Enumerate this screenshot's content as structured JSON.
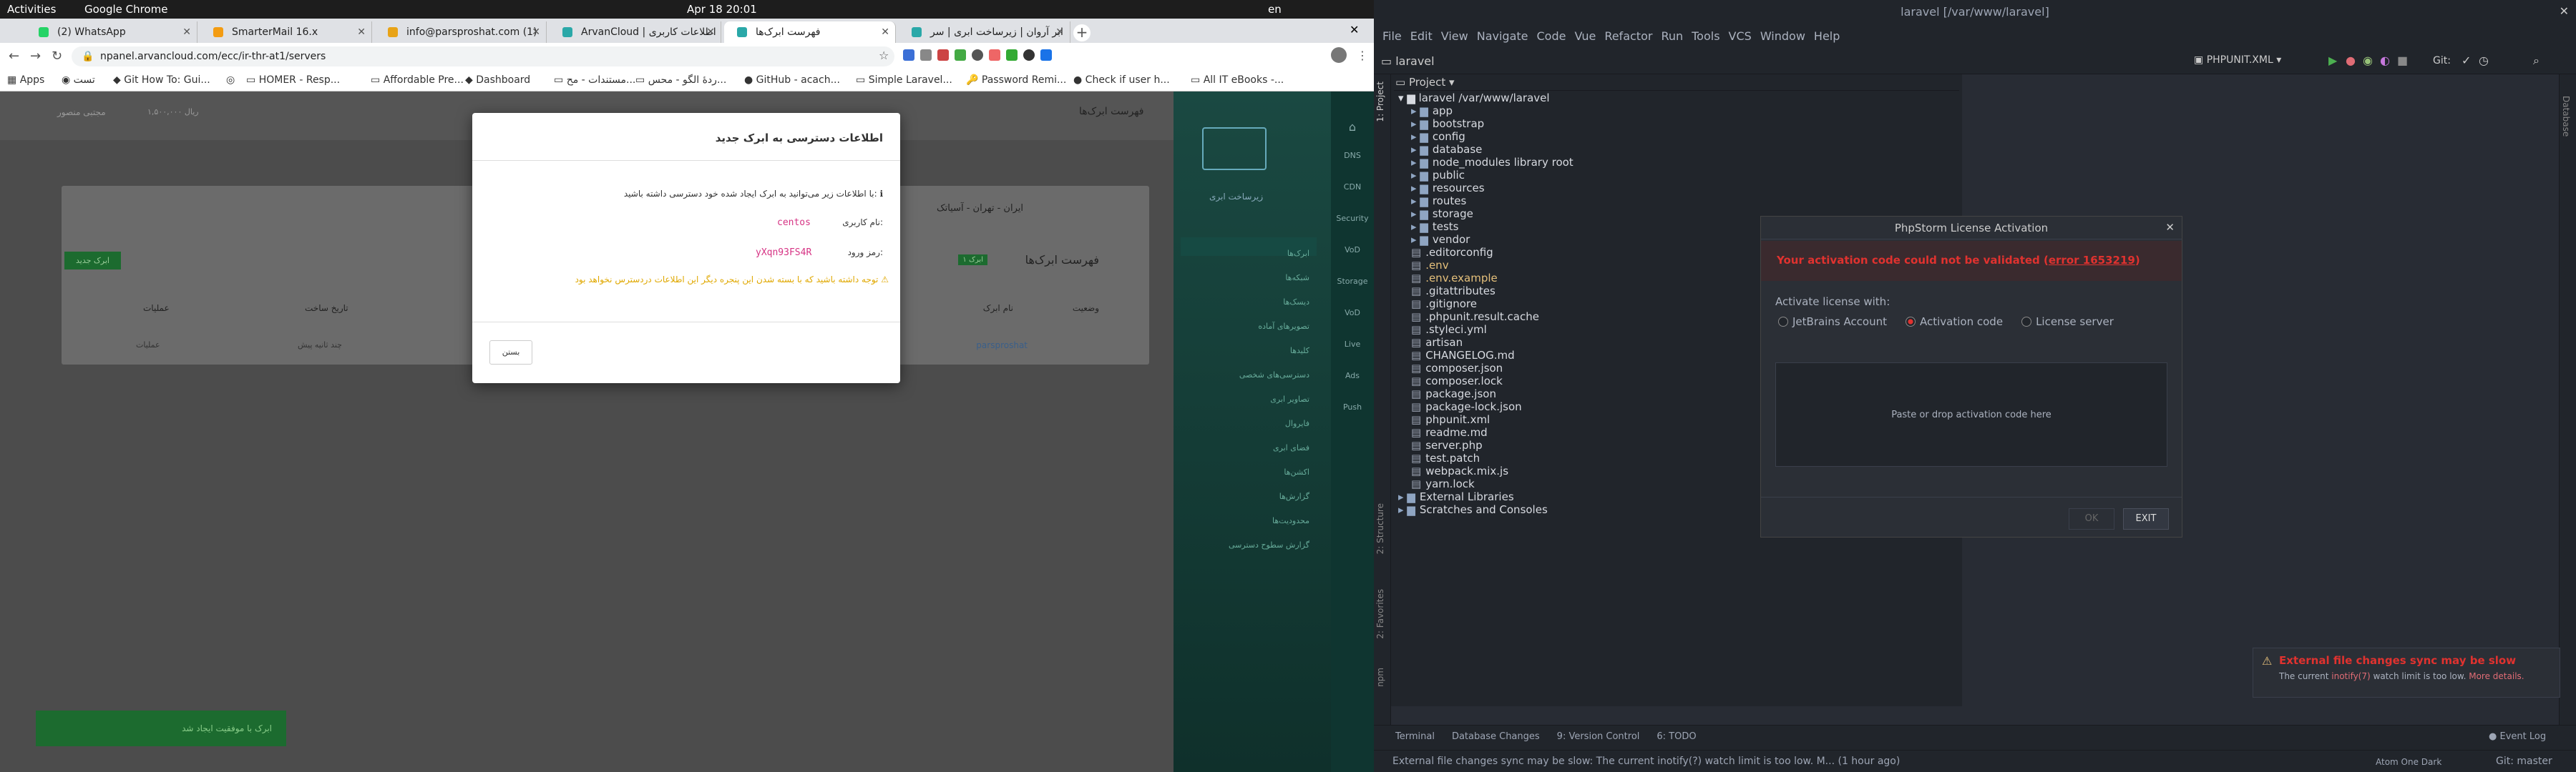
{
  "topbar": {
    "activities": "Activities",
    "app": "Google Chrome",
    "clock": "Apr 18  20:01",
    "lang": "en"
  },
  "chrome": {
    "tabs": [
      "(2) WhatsApp",
      "SmarterMail 16.x",
      "info@parsproshat.com (1)",
      "ArvanCloud | اطلاعات کاربری",
      "فهرست ابرک‌ها",
      "ابر آروان | زیرساخت ابری | سر"
    ],
    "active_tab": 4,
    "url": "npanel.arvancloud.com/ecc/ir-thr-at1/servers",
    "bookmarks": [
      "Apps",
      "تست",
      "Git How To: Gui...",
      "",
      "HOMER - Resp...",
      "Affordable Pre...",
      "Dashboard",
      "مستندات - مح...",
      "ردهٔ الگو - محس...",
      "GitHub - acach...",
      "Simple Laravel...",
      "Password Remi...",
      "Check if user h...",
      "All IT eBooks -..."
    ]
  },
  "panel": {
    "page_heading": "فهرست ابرک‌ها",
    "user_name": "مجتبی منصور",
    "balance": "۱,۵۰۰,۰۰۰ ریال",
    "region": "ایران - تهران - آسیاتک",
    "list_title": "فهرست ابرک‌ها",
    "list_badge": "۱ ابرک",
    "create_button": "ابرک جدید",
    "columns": [
      "وضعیت",
      "نام ابرک",
      "",
      "تاریخ ساخت",
      "عملیات"
    ],
    "row": {
      "name": "parsproshat",
      "created": "چند ثانیه پیش",
      "actions": "عملیات"
    },
    "toast": "ابرک با موفقیت ایجاد شد",
    "sidebar_brand": "زیرساخت ابری",
    "sidebar_items": [
      "ابرک‌ها",
      "شبکه‌ها",
      "دیسک‌ها",
      "تصویرهای آماده",
      "کلیدها",
      "دسترسی‌های شخصی",
      "تصاویر ابری",
      "فایروال",
      "فضای ابری",
      "اکشن‌ها",
      "گزارش‌ها",
      "محدودیت‌ها",
      "گزارش سطوح دسترسی"
    ],
    "side_icons": [
      "DNS",
      "CDN",
      "Security",
      "VoD",
      "Storage",
      "VoD",
      "Live",
      "Ads",
      "Push"
    ]
  },
  "modal": {
    "title": "اطلاعات دسترسی به ابرک جدید",
    "intro": "با اطلاعات زیر می‌توانید به ابرک ایجاد شده خود دسترسی داشته باشید:",
    "user_label": "نام کاربری:",
    "user_value": "centos",
    "pass_label": "رمز ورود:",
    "pass_value": "yXqn93FS4R",
    "warning": "توجه داشته باشید که با بسته شدن این پنجره دیگر این اطلاعات دردسترس نخواهد بود",
    "close": "بستن"
  },
  "ide": {
    "title": "laravel [/var/www/laravel]",
    "menu": [
      "File",
      "Edit",
      "View",
      "Navigate",
      "Code",
      "Vue",
      "Refactor",
      "Run",
      "Tools",
      "VCS",
      "Window",
      "Help"
    ],
    "breadcrumb": "laravel",
    "run_config": "PHPUNIT.XML",
    "git_label": "Git:",
    "project_header": "Project",
    "root": "laravel  /var/www/laravel",
    "tree": [
      "app",
      "bootstrap",
      "config",
      "database",
      "node_modules  library root",
      "public",
      "resources",
      "routes",
      "storage",
      "tests",
      "vendor",
      ".editorconfig",
      ".env",
      ".env.example",
      ".gitattributes",
      ".gitignore",
      ".phpunit.result.cache",
      ".styleci.yml",
      "artisan",
      "CHANGELOG.md",
      "composer.json",
      "composer.lock",
      "package.json",
      "package-lock.json",
      "phpunit.xml",
      "readme.md",
      "server.php",
      "test.patch",
      "webpack.mix.js",
      "yarn.lock",
      "External Libraries",
      "Scratches and Consoles"
    ],
    "side_tabs": [
      "1: Project",
      "2: Structure",
      "2: Favorites",
      "npm"
    ],
    "right_tabs": [
      "Database"
    ],
    "bottom_tabs": [
      "Terminal",
      "Database Changes",
      "9: Version Control",
      "6: TODO"
    ],
    "event_log": "Event Log",
    "status_msg": "External file changes sync may be slow: The current inotify(?) watch limit is too low. M... (1 hour ago)",
    "theme": "Atom One Dark",
    "git_branch": "Git: master",
    "license": {
      "title": "PhpStorm License Activation",
      "error": "Your activation code could not be validated (",
      "error_link": "error 1653219",
      "error_end": ")",
      "activate_label": "Activate license with:",
      "options": [
        "JetBrains Account",
        "Activation code",
        "License server"
      ],
      "selected": 1,
      "drop": "Paste or drop activation code here",
      "ok": "OK",
      "exit": "EXIT"
    },
    "notif": {
      "title": "External file changes sync may be slow",
      "body1": "The current ",
      "body_link": "inotify(7)",
      "body2": " watch limit is too low. ",
      "more": "More details."
    }
  },
  "colors": {
    "ide_bg": "#282c34",
    "error": "#e0322f",
    "accent": "#1e8c3c",
    "pink": "#d63384"
  }
}
